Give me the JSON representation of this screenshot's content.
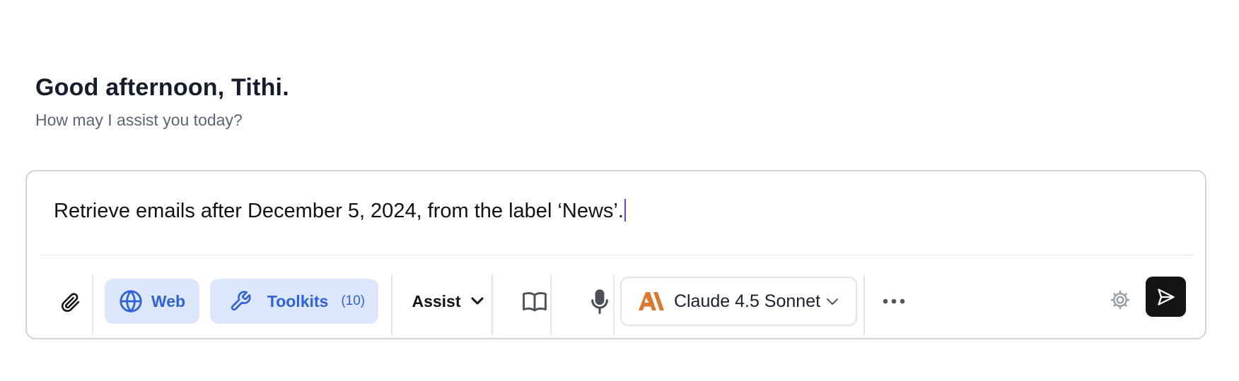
{
  "greeting": {
    "title": "Good afternoon, Tithi.",
    "subtitle": "How may I assist you today?"
  },
  "composer": {
    "input_value": "Retrieve emails after December 5, 2024, from the label ‘News’."
  },
  "toolbar": {
    "attach_icon": "paperclip-icon",
    "web_label": "Web",
    "web_icon": "globe-icon",
    "toolkits_label": "Toolkits",
    "toolkits_count": "(10)",
    "toolkits_icon": "wrench-icon",
    "assist_label": "Assist",
    "library_icon": "book-icon",
    "mic_icon": "microphone-icon",
    "model_label": "Claude 4.5 Sonnet",
    "model_icon": "anthropic-logo-icon",
    "more_icon": "more-horizontal-icon",
    "settings_icon": "gear-icon",
    "send_icon": "send-icon"
  },
  "colors": {
    "chip_bg": "#dde7fb",
    "chip_text": "#2f62d8",
    "anthropic": "#d97a32",
    "send_bg": "#141414",
    "caret": "#6a3df0"
  }
}
